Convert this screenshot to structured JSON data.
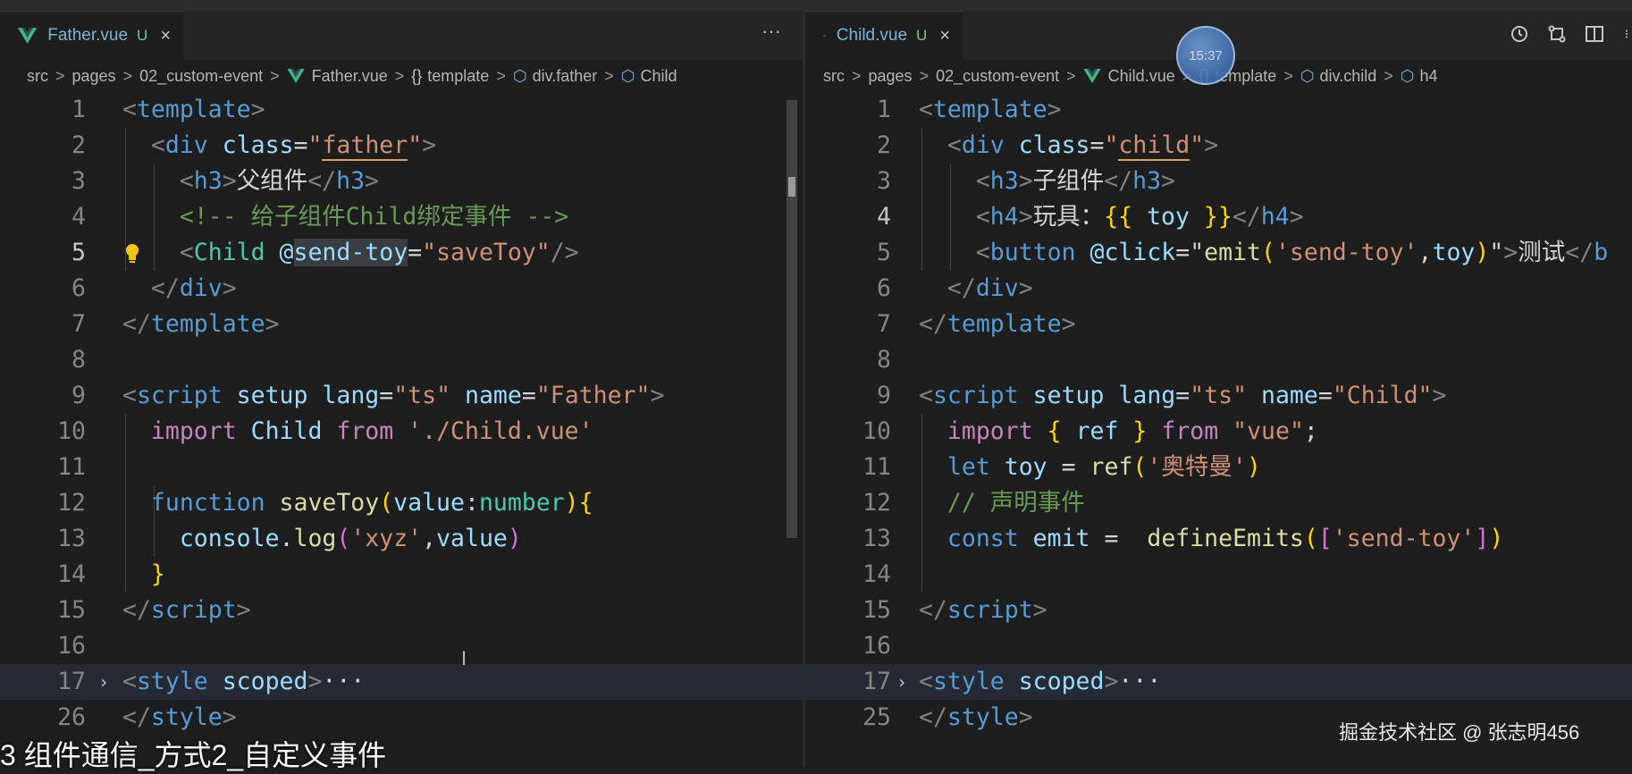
{
  "left": {
    "tab": {
      "name": "Father.vue",
      "status": "U",
      "close": "×"
    },
    "more": "···",
    "breadcrumb": [
      "src",
      "pages",
      "02_custom-event",
      "Father.vue",
      "template",
      "div.father",
      "Child"
    ],
    "line_numbers": [
      "1",
      "2",
      "3",
      "4",
      "5",
      "6",
      "7",
      "8",
      "9",
      "10",
      "11",
      "12",
      "13",
      "14",
      "15",
      "16",
      "17",
      "26"
    ]
  },
  "right": {
    "tab": {
      "name": "Child.vue",
      "status": "U",
      "close": "×"
    },
    "breadcrumb": [
      "src",
      "pages",
      "02_custom-event",
      "Child.vue",
      "template",
      "div.child",
      "h4"
    ],
    "line_numbers": [
      "1",
      "2",
      "3",
      "4",
      "5",
      "6",
      "7",
      "8",
      "9",
      "10",
      "11",
      "12",
      "13",
      "14",
      "15",
      "16",
      "17",
      "25"
    ]
  },
  "overlay": {
    "clock": "15:37",
    "caption": "3 组件通信_方式2_自定义事件",
    "watermark": "掘金技术社区 @ 张志明456",
    "cursor": "I"
  },
  "colors": {
    "background": "#1e1e1e",
    "tag": "#569cd6",
    "string": "#ce9178",
    "keyword": "#c586c0",
    "function": "#dcdcaa",
    "comment": "#6a9955"
  }
}
